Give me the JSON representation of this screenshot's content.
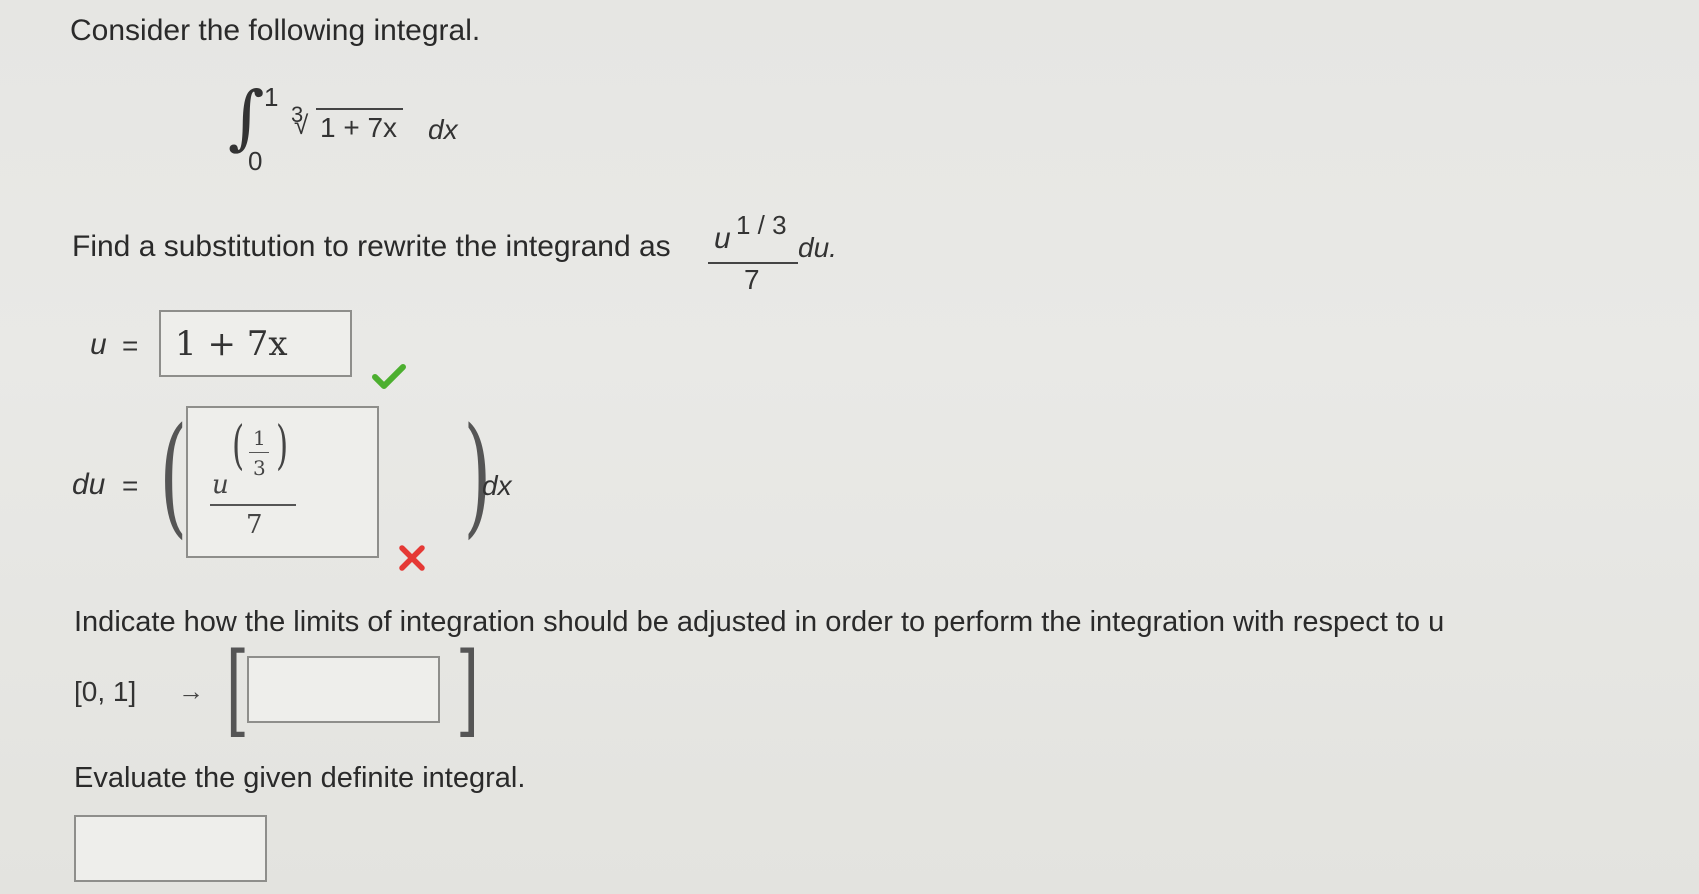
{
  "question": {
    "intro": "Consider the following integral.",
    "integral": {
      "lower": "0",
      "upper": "1",
      "root_index": "3",
      "radicand": "1 + 7x",
      "differential": "dx"
    },
    "substitution_prompt": "Find a substitution to rewrite the integrand as",
    "target_form": {
      "numerator_base": "u",
      "numerator_exponent": "1 / 3",
      "denominator": "7",
      "trailing": "du."
    }
  },
  "u_row": {
    "label": "u",
    "equals": "=",
    "answer": "1 + 7x",
    "status": "correct",
    "status_color": "#4caf2f"
  },
  "du_row": {
    "label": "du",
    "equals": "=",
    "answer_base": "u",
    "answer_exp_numerator": "1",
    "answer_exp_denominator": "3",
    "answer_denominator": "7",
    "differential": "dx",
    "status": "incorrect",
    "status_color": "#e53935"
  },
  "limits": {
    "prompt": "Indicate how the limits of integration should be adjusted in order to perform the integration with respect to u",
    "original": "[0, 1]",
    "arrow": "→",
    "answer": ""
  },
  "evaluate": {
    "prompt": "Evaluate the given definite integral.",
    "answer": ""
  }
}
